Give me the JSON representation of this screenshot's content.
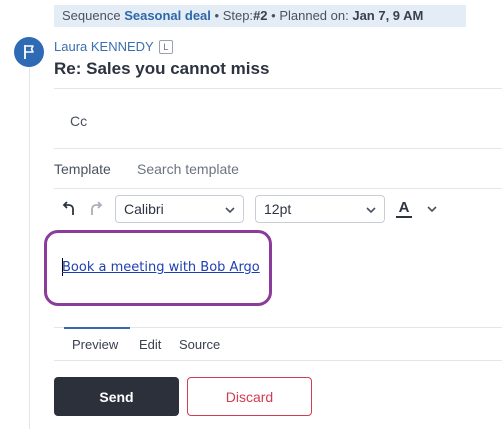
{
  "sequence_banner": {
    "prefix": "Sequence",
    "sequence_name": "Seasonal deal",
    "step_label": "• Step:",
    "step_value": "#2",
    "planned_label": "• Planned on:",
    "planned_value": "Jan 7, 9 AM"
  },
  "email": {
    "sender_name": "Laura KENNEDY",
    "sender_badge": "L",
    "subject": "Re: Sales you cannot miss",
    "cc_label": "Cc"
  },
  "template": {
    "label": "Template",
    "search_placeholder": "Search template"
  },
  "toolbar": {
    "font_family": "Calibri",
    "font_size": "12pt",
    "text_color_glyph": "A"
  },
  "editor": {
    "link_text": "Book a meeting with Bob Argo"
  },
  "tabs": [
    {
      "label": "Preview",
      "active": true
    },
    {
      "label": "Edit",
      "active": false
    },
    {
      "label": "Source",
      "active": false
    }
  ],
  "actions": {
    "send_label": "Send",
    "discard_label": "Discard"
  },
  "colors": {
    "accent": "#2f6ab5",
    "highlight_border": "#8b3c9b",
    "discard": "#d23c50",
    "send_bg": "#2c303b"
  }
}
